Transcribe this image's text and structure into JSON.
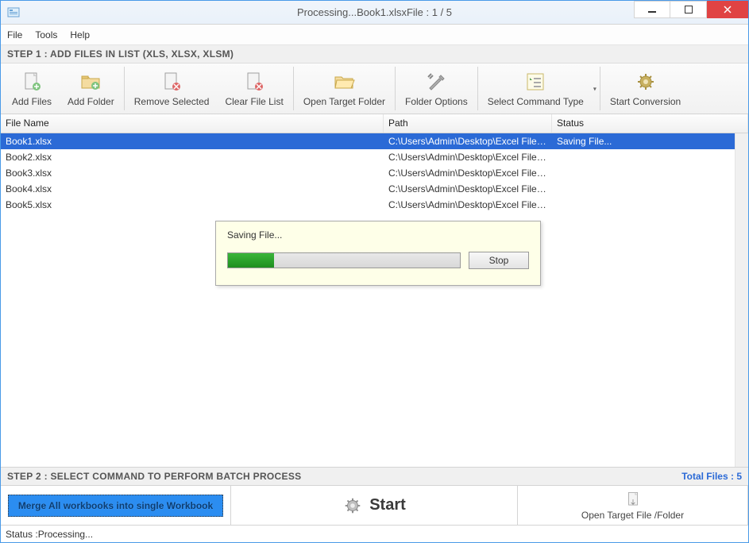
{
  "window": {
    "title": "Processing...Book1.xlsxFile : 1 / 5"
  },
  "menu": {
    "file": "File",
    "tools": "Tools",
    "help": "Help"
  },
  "step1_header": "STEP 1 : ADD FILES IN LIST (XLS, XLSX, XLSM)",
  "toolbar": {
    "add_files": "Add Files",
    "add_folder": "Add Folder",
    "remove_selected": "Remove Selected",
    "clear_file_list": "Clear File List",
    "open_target_folder": "Open Target Folder",
    "folder_options": "Folder Options",
    "select_command_type": "Select Command Type",
    "start_conversion": "Start Conversion"
  },
  "columns": {
    "file_name": "File Name",
    "path": "Path",
    "status": "Status"
  },
  "rows": [
    {
      "name": "Book1.xlsx",
      "path": "C:\\Users\\Admin\\Desktop\\Excel Files\\Book...",
      "status": "Saving File...",
      "selected": true
    },
    {
      "name": "Book2.xlsx",
      "path": "C:\\Users\\Admin\\Desktop\\Excel Files\\Book...",
      "status": "",
      "selected": false
    },
    {
      "name": "Book3.xlsx",
      "path": "C:\\Users\\Admin\\Desktop\\Excel Files\\Book...",
      "status": "",
      "selected": false
    },
    {
      "name": "Book4.xlsx",
      "path": "C:\\Users\\Admin\\Desktop\\Excel Files\\Book...",
      "status": "",
      "selected": false
    },
    {
      "name": "Book5.xlsx",
      "path": "C:\\Users\\Admin\\Desktop\\Excel Files\\Book...",
      "status": "",
      "selected": false
    }
  ],
  "progress": {
    "message": "Saving File...",
    "stop_label": "Stop",
    "percent": 20
  },
  "step2_header": "STEP 2 : SELECT COMMAND TO PERFORM BATCH PROCESS",
  "total_files_label": "Total Files : 5",
  "command_pill": "Merge All workbooks into single Workbook",
  "start_label": "Start",
  "open_target_label": "Open Target File /Folder",
  "status_prefix": "Status  :  ",
  "status_value": "Processing..."
}
